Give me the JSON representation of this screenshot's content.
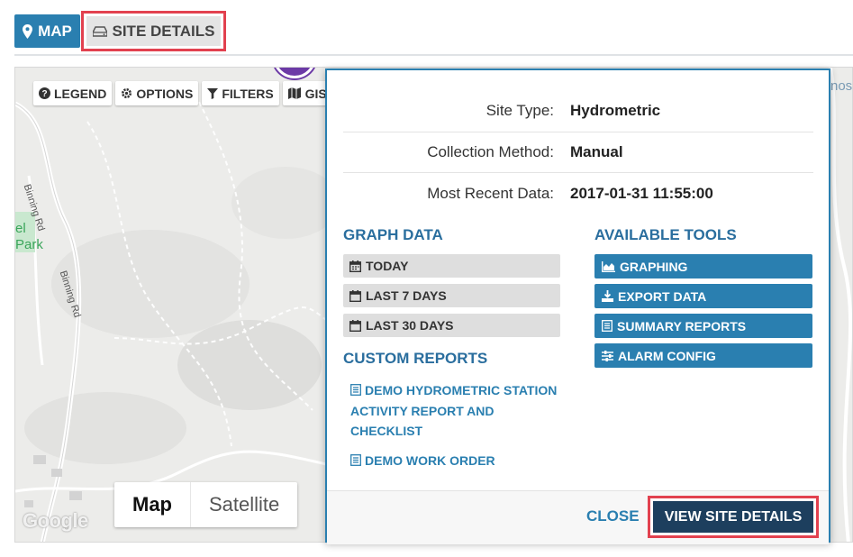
{
  "tabs": {
    "map_label": "MAP",
    "site_details_label": "SITE DETAILS"
  },
  "map": {
    "toolbar": {
      "legend": "LEGEND",
      "options": "OPTIONS",
      "filters": "FILTERS",
      "gis_maps": "GIS MAPS"
    },
    "road_labels": [
      "Binning Rd",
      "Binning Rd"
    ],
    "park_label_1": "el",
    "park_label_2": "Park",
    "top_right_fragment": "nosu",
    "map_type": {
      "map": "Map",
      "satellite": "Satellite"
    },
    "attribution": "Google"
  },
  "popup": {
    "info": [
      {
        "label": "Site Type:",
        "value": "Hydrometric"
      },
      {
        "label": "Collection Method:",
        "value": "Manual"
      },
      {
        "label": "Most Recent Data:",
        "value": "2017-01-31 11:55:00"
      }
    ],
    "graph_data_heading": "GRAPH DATA",
    "graph_buttons": [
      "TODAY",
      "LAST 7 DAYS",
      "LAST 30 DAYS"
    ],
    "custom_reports_heading": "CUSTOM REPORTS",
    "custom_reports": [
      "DEMO HYDROMETRIC STATION ACTIVITY REPORT AND CHECKLIST",
      "DEMO WORK ORDER"
    ],
    "available_tools_heading": "AVAILABLE TOOLS",
    "tools": [
      "GRAPHING",
      "EXPORT DATA",
      "SUMMARY REPORTS",
      "ALARM CONFIG"
    ],
    "close_label": "CLOSE",
    "view_details_label": "VIEW SITE DETAILS"
  },
  "colors": {
    "primary": "#2a7fb0",
    "dark_button": "#1d3f5e",
    "highlight_outline": "#e2414f",
    "heading_text": "#2a6e9e"
  }
}
